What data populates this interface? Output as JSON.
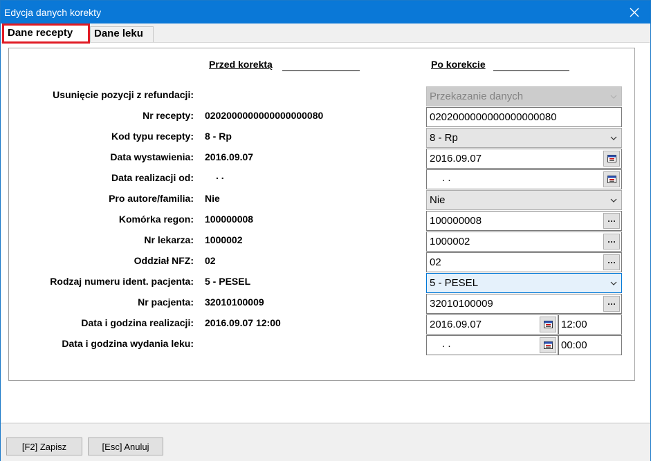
{
  "window": {
    "title": "Edycja danych korekty"
  },
  "tabs": [
    {
      "label": "Dane recepty",
      "active": true
    },
    {
      "label": "Dane leku",
      "active": false
    }
  ],
  "columns": {
    "before": "Przed korektą",
    "after": "Po korekcie"
  },
  "rows": [
    {
      "label": "Usunięcie pozycji z refundacji:",
      "before": "",
      "after": "Przekazanie danych"
    },
    {
      "label": "Nr recepty:",
      "before": "0202000000000000000080",
      "after": "0202000000000000000080"
    },
    {
      "label": "Kod typu recepty:",
      "before": "8 - Rp",
      "after": "8 - Rp"
    },
    {
      "label": "Data wystawienia:",
      "before": "2016.09.07",
      "after": "2016.09.07"
    },
    {
      "label": "Data realizacji od:",
      "before": ". .",
      "after": ". ."
    },
    {
      "label": "Pro autore/familia:",
      "before": "Nie",
      "after": "Nie"
    },
    {
      "label": "Komórka regon:",
      "before": "100000008",
      "after": "100000008"
    },
    {
      "label": "Nr lekarza:",
      "before": "1000002",
      "after": "1000002"
    },
    {
      "label": "Oddział NFZ:",
      "before": "02",
      "after": "02"
    },
    {
      "label": "Rodzaj numeru ident. pacjenta:",
      "before": "5 - PESEL",
      "after": "5 - PESEL"
    },
    {
      "label": "Nr pacjenta:",
      "before": "32010100009",
      "after": "32010100009"
    },
    {
      "label": "Data i godzina realizacji:",
      "before": "2016.09.07 12:00",
      "after": "2016.09.07",
      "after_time": "12:00"
    },
    {
      "label": "Data i godzina wydania leku:",
      "before": "",
      "after": ". .",
      "after_time": "00:00"
    }
  ],
  "footer": {
    "save": "[F2] Zapisz",
    "cancel": "[Esc] Anuluj"
  },
  "colors": {
    "titlebar": "#0a78d7",
    "active_tab_border": "#e01b24",
    "focus": "#0078d7"
  }
}
